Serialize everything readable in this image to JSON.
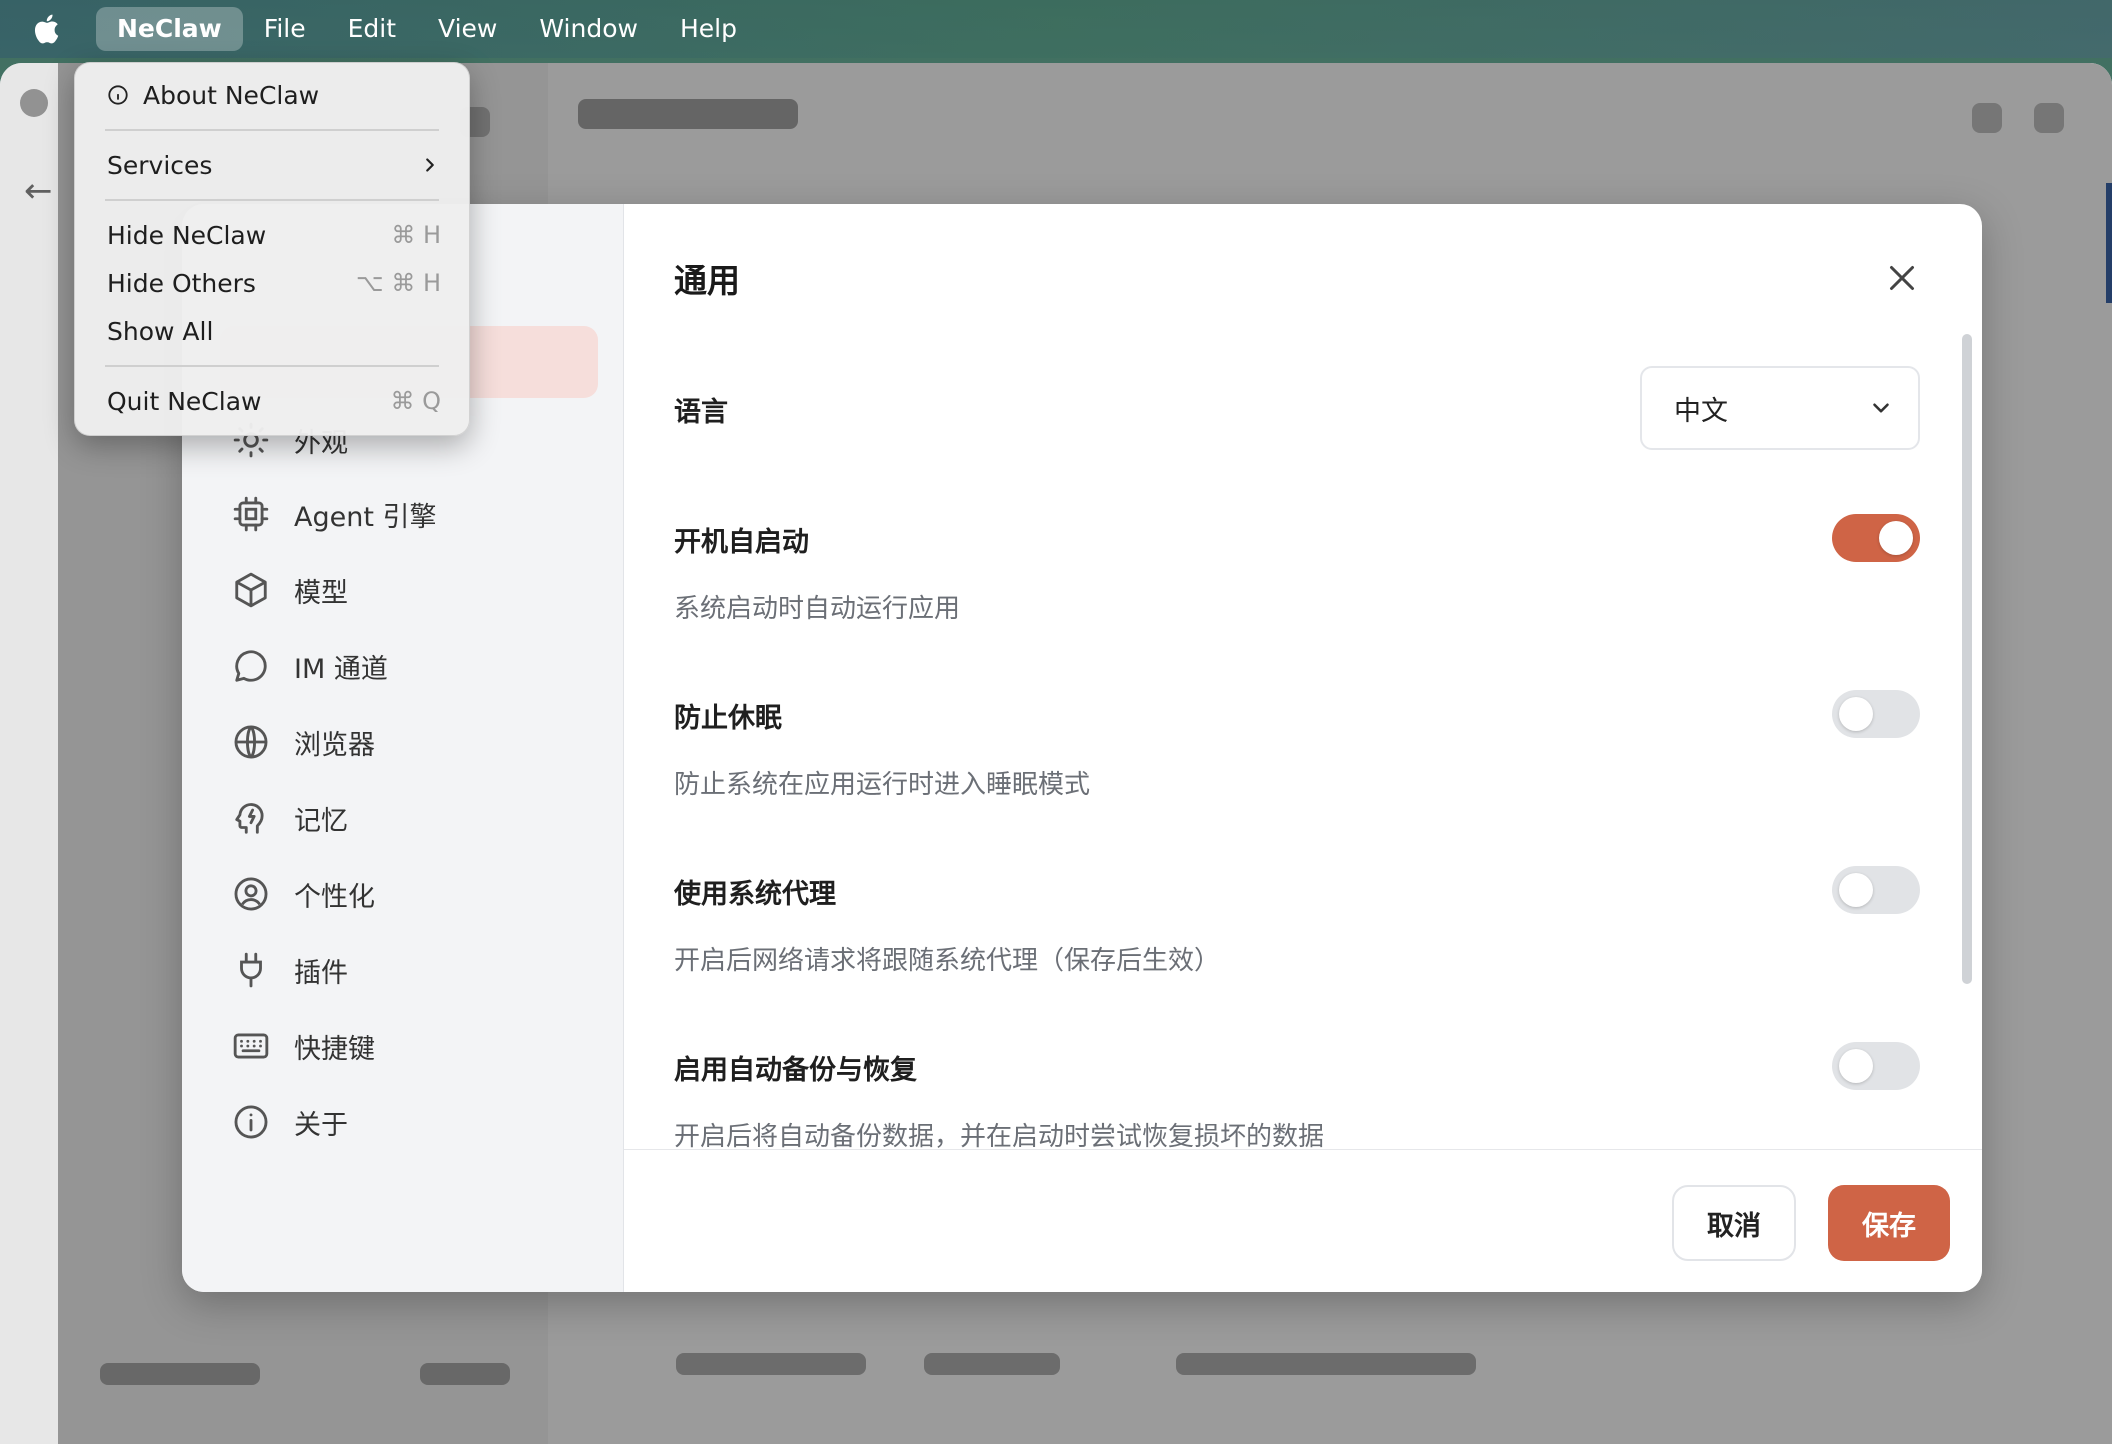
{
  "menubar": {
    "app_name": "NeClaw",
    "items": [
      "File",
      "Edit",
      "View",
      "Window",
      "Help"
    ]
  },
  "app_menu": {
    "about": "About NeClaw",
    "services": "Services",
    "hide": "Hide NeClaw",
    "hide_shortcut": "⌘ H",
    "hide_others": "Hide Others",
    "hide_others_shortcut": "⌥ ⌘ H",
    "show_all": "Show All",
    "quit": "Quit NeClaw",
    "quit_shortcut": "⌘ Q"
  },
  "settings": {
    "title": "通用",
    "nav": [
      {
        "label": "外观",
        "icon": "sun-icon"
      },
      {
        "label": "Agent 引擎",
        "icon": "cpu-icon"
      },
      {
        "label": "模型",
        "icon": "cube-icon"
      },
      {
        "label": "IM 通道",
        "icon": "chat-icon"
      },
      {
        "label": "浏览器",
        "icon": "globe-icon"
      },
      {
        "label": "记忆",
        "icon": "brain-icon"
      },
      {
        "label": "个性化",
        "icon": "user-circle-icon"
      },
      {
        "label": "插件",
        "icon": "plug-icon"
      },
      {
        "label": "快捷键",
        "icon": "keyboard-icon"
      },
      {
        "label": "关于",
        "icon": "info-icon"
      }
    ],
    "language": {
      "label": "语言",
      "value": "中文"
    },
    "options": [
      {
        "label": "开机自启动",
        "desc": "系统启动时自动运行应用",
        "enabled": true
      },
      {
        "label": "防止休眠",
        "desc": "防止系统在应用运行时进入睡眠模式",
        "enabled": false
      },
      {
        "label": "使用系统代理",
        "desc": "开启后网络请求将跟随系统代理（保存后生效）",
        "enabled": false
      },
      {
        "label": "启用自动备份与恢复",
        "desc": "开启后将自动备份数据，并在启动时尝试恢复损坏的数据",
        "enabled": false
      }
    ],
    "cancel_label": "取消",
    "save_label": "保存"
  },
  "colors": {
    "accent": "#cf6446",
    "toggle_off": "#e1e3e6",
    "nav_bg": "#f3f4f6"
  }
}
